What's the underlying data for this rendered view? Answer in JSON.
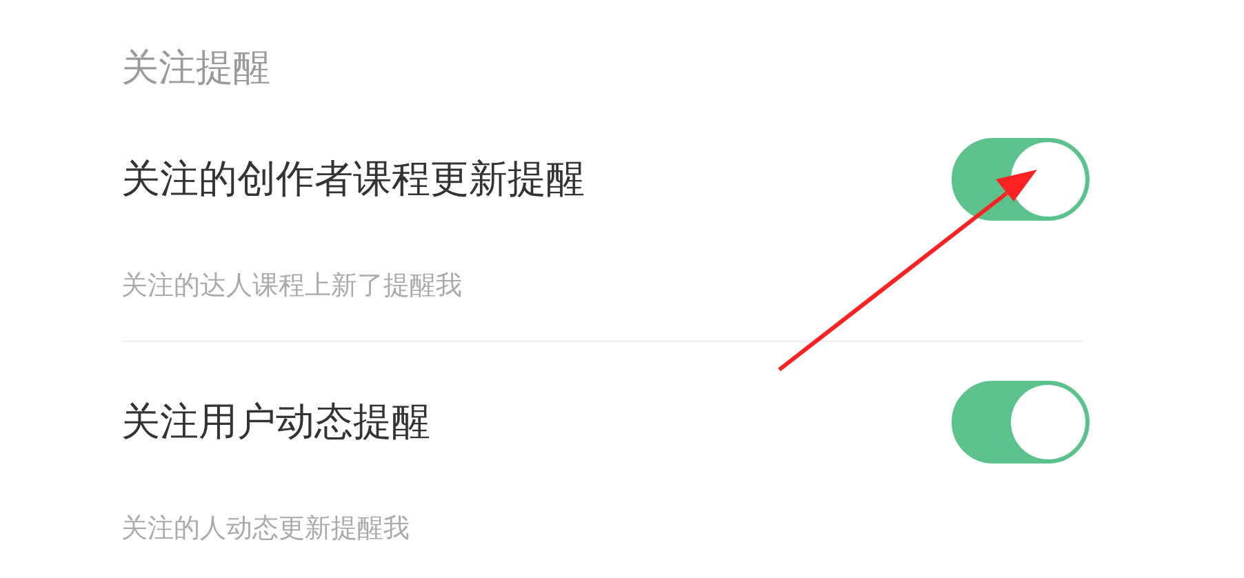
{
  "section_title": "关注提醒",
  "settings": [
    {
      "title": "关注的创作者课程更新提醒",
      "description": "关注的达人课程上新了提醒我",
      "on": true
    },
    {
      "title": "关注用户动态提醒",
      "description": "关注的人动态更新提醒我",
      "on": true
    }
  ]
}
